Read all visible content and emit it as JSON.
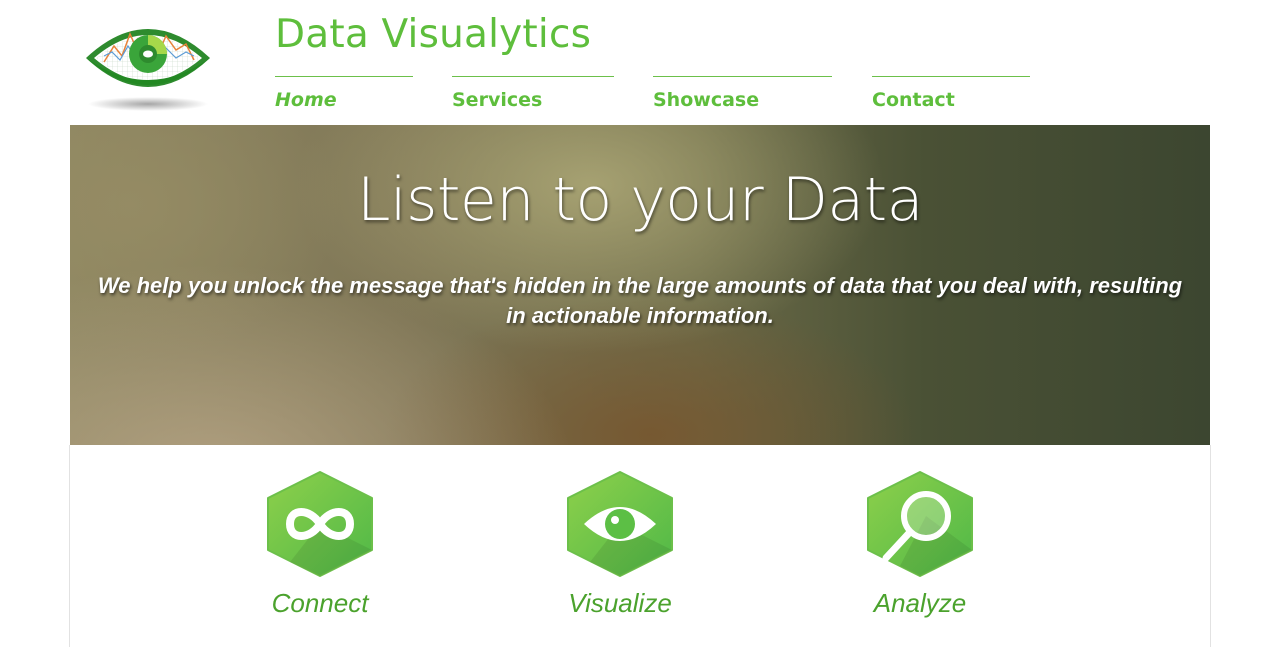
{
  "header": {
    "brand": "Data Visualytics",
    "nav": [
      {
        "label": "Home",
        "active": true
      },
      {
        "label": "Services",
        "active": false
      },
      {
        "label": "Showcase",
        "active": false
      },
      {
        "label": "Contact",
        "active": false
      }
    ]
  },
  "hero": {
    "title": "Listen to your Data",
    "subtitle": "We help you unlock the message that's hidden in the large amounts of data that you deal with, resulting in actionable information."
  },
  "features": [
    {
      "label": "Connect",
      "icon": "infinity-icon"
    },
    {
      "label": "Visualize",
      "icon": "eye-icon"
    },
    {
      "label": "Analyze",
      "icon": "magnifier-icon"
    }
  ],
  "colors": {
    "brand_green": "#5ebe3c",
    "icon_green": "#6cc04a",
    "label_green": "#4ba22d"
  }
}
